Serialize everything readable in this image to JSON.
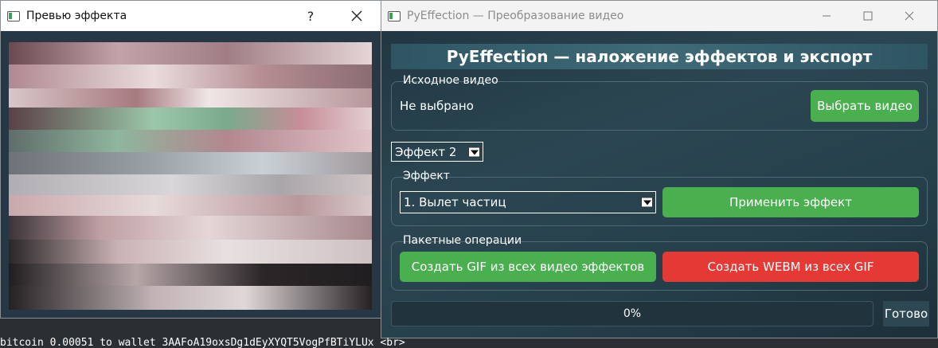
{
  "preview_window": {
    "title": "Превью эффекта",
    "help_button": "?",
    "close_icon": "close-icon"
  },
  "main_window": {
    "title": "PyEffection — Преобразование видео",
    "banner": "PyEffection — наложение эффектов и экспорт",
    "source_group": {
      "title": "Исходное видео",
      "file_label": "Не выбрано",
      "choose_button": "Выбрать видео"
    },
    "effect_tab_select": "Эффект 2",
    "effect_group": {
      "title": "Эффект",
      "selected_effect": "1. Вылет частиц",
      "apply_button": "Применить эффект"
    },
    "batch_group": {
      "title": "Пакетные операции",
      "gif_button": "Создать GIF из всех видео эффектов",
      "webm_button": "Создать WEBM из всех GIF"
    },
    "progress": {
      "text": "0%",
      "value": 0
    },
    "status": "Готово"
  },
  "terminal": {
    "line": "bitcoin 0.00051 to wallet 3AAFoA19oxsDg1dEyXYQT5VogPfBTiYLUx <br>"
  },
  "colors": {
    "accent_green": "#4aaf4f",
    "accent_red": "#e53935",
    "window_bg": "#2b4652"
  }
}
